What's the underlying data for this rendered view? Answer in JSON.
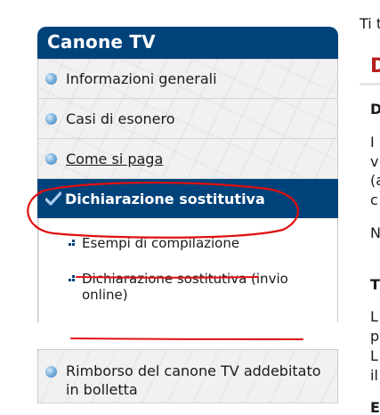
{
  "sidebar": {
    "title": "Canone TV",
    "items": [
      {
        "label": "Informazioni generali",
        "icon": "bullet-icon"
      },
      {
        "label": "Casi di esonero",
        "icon": "bullet-icon"
      },
      {
        "label": "Come si paga",
        "icon": "bullet-icon"
      },
      {
        "label": "Dichiarazione sostitutiva",
        "icon": "check-icon",
        "active": true
      }
    ],
    "subitems": [
      {
        "label": "Esempi di compilazione"
      },
      {
        "label": "Dichiarazione sostitutiva (invio online)"
      }
    ],
    "lower_item": {
      "label": "Rimborso del canone TV addebitato in bolletta",
      "icon": "bullet-icon"
    }
  },
  "right": {
    "top": "Ti t",
    "heading": "D",
    "lines": [
      "D",
      "I",
      "v",
      "(a",
      "c",
      "N",
      "T",
      "L",
      "p",
      "L",
      "il",
      "E"
    ]
  },
  "colors": {
    "header_bg": "#00427a",
    "active_bg": "#00427a",
    "heading_red": "#b71c1c",
    "annotation_red": "#e01010"
  }
}
